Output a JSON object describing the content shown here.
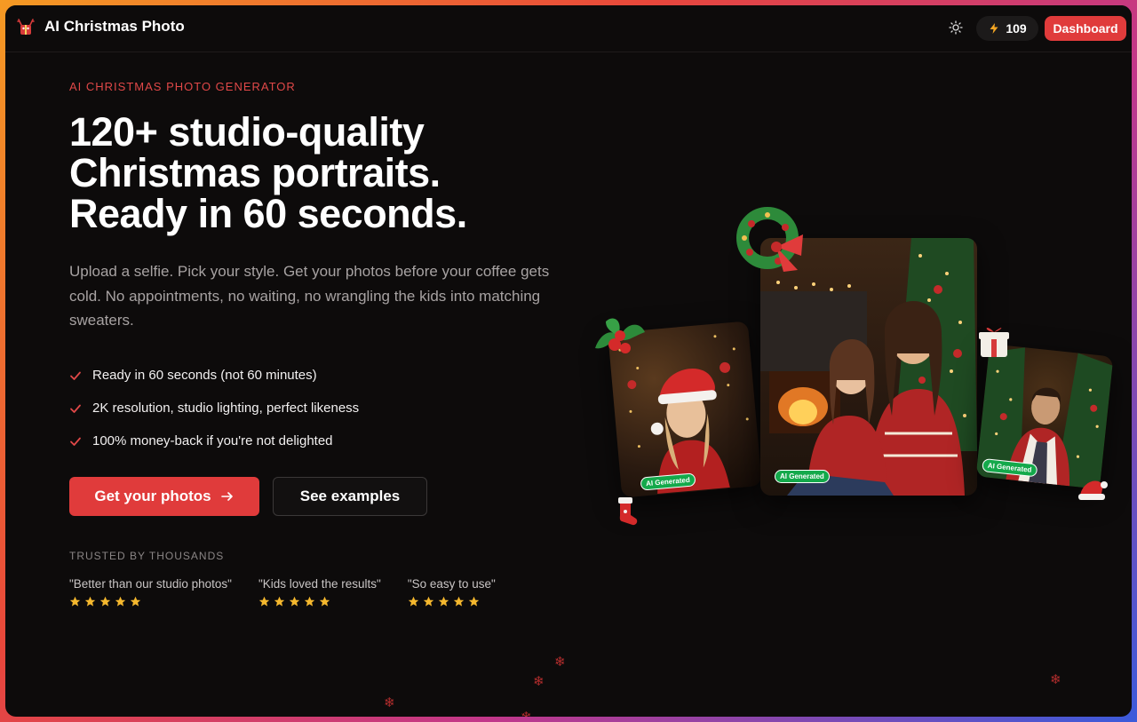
{
  "header": {
    "brand_name": "AI Christmas Photo",
    "credits": "109",
    "dashboard_label": "Dashboard",
    "icons": {
      "logo": "reindeer-gift-icon",
      "theme": "sun-icon",
      "credits": "lightning-bolt-icon"
    }
  },
  "hero": {
    "eyebrow": "AI CHRISTMAS PHOTO GENERATOR",
    "headline": [
      "120+ studio-quality",
      "Christmas portraits.",
      "Ready in 60 seconds."
    ],
    "lede": "Upload a selfie. Pick your style. Get your photos before your coffee gets cold. No appointments, no waiting, no wrangling the kids into matching sweaters.",
    "features": [
      "Ready in 60 seconds (not 60 minutes)",
      "2K resolution, studio lighting, perfect likeness",
      "100% money-back if you're not delighted"
    ],
    "primary_cta": "Get your photos",
    "secondary_cta": "See examples",
    "trusted_label": "TRUSTED BY THOUSANDS",
    "testimonials": [
      {
        "quote": "\"Better than our studio photos\"",
        "rating": 5
      },
      {
        "quote": "\"Kids loved the results\"",
        "rating": 5
      },
      {
        "quote": "\"So easy to use\"",
        "rating": 5
      }
    ]
  },
  "collage": {
    "badge_label": "AI Generated",
    "photos": [
      "woman-in-santa-hat-photo",
      "mother-and-daughter-by-fireplace-photo",
      "man-in-christmas-sweater-photo"
    ]
  },
  "colors": {
    "accent": "#e03b3b",
    "background": "#0d0b0b",
    "star": "#f5b82e",
    "badge": "#14a94b"
  }
}
